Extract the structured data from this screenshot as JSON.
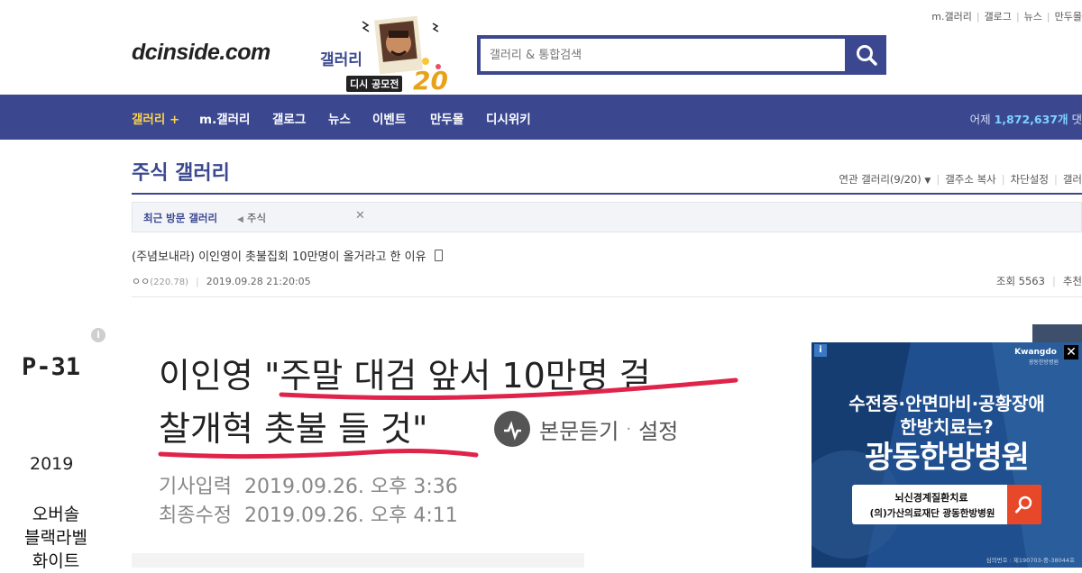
{
  "header": {
    "top_links": [
      "m.갤러리",
      "갤로그",
      "뉴스",
      "만두몰"
    ],
    "logo": "dcinside.com",
    "logo_gallery": "갤러리",
    "promo_badge": "디시 공모전",
    "promo_number": "20",
    "search_placeholder": "갤러리 & 통합검색"
  },
  "nav": {
    "items": [
      "갤러리 +",
      "m.갤러리",
      "갤로그",
      "뉴스",
      "이벤트",
      "만두몰",
      "디시위키"
    ],
    "visits_prefix": "어제",
    "visits_count": "1,872,637개",
    "visits_suffix": "댓"
  },
  "gallery": {
    "title": "주식 갤러리",
    "tools": [
      "연관 갤러리(9/20)",
      "갤주소 복사",
      "차단설정",
      "갤러"
    ],
    "recent_label": "최근 방문 갤러리",
    "recent_item": "주식"
  },
  "post": {
    "title": "(주념보내라) 이인영이 촛불집회 10만명이 올거라고 한 이유",
    "author": "ㅇㅇ",
    "ip": "(220.78)",
    "datetime": "2019.09.28 21:20:05",
    "views": "조회 5563",
    "recommend": "추천"
  },
  "article": {
    "headline_line1_prefix": "이인영 ",
    "headline_line1_quote": "\"주말 대검 앞서 10만명 걸",
    "headline_line2": "찰개혁 촛불 들 것\"",
    "listen": "본문듣기",
    "settings": "설정",
    "input_label": "기사입력",
    "input_date": "2019.09.26. 오후 3:36",
    "edit_label": "최종수정",
    "edit_date": "2019.09.26. 오후 4:11"
  },
  "left_ad": {
    "code": "P-31",
    "year": "2019",
    "line1": "오버솔",
    "line2": "블랙라벨",
    "line3": "화이트"
  },
  "right_ad": {
    "brand": "Kwangdo",
    "brand_sub": "광동한방병원",
    "line1": "수전증·안면마비·공황장애",
    "line2": "한방치료는?",
    "big": "광동한방병원",
    "search_line1": "뇌신경계질환치료",
    "search_line2": "(의)가산의료재단 광동한방병원",
    "license": "심의번호 : 제190703-중-38044호"
  },
  "colors": {
    "brand_blue": "#3b4890",
    "nav_active": "#ffd24d",
    "underline_red": "#e0234a",
    "ad_blue": "#1f4f8f",
    "ad_orange": "#e8482a"
  }
}
